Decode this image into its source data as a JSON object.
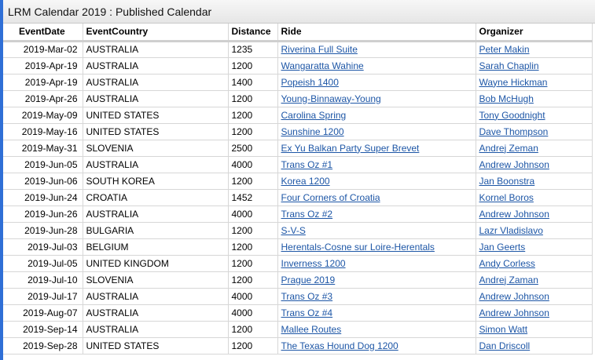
{
  "window": {
    "title": "LRM Calendar 2019 : Published Calendar"
  },
  "table": {
    "columns": [
      "EventDate",
      "EventCountry",
      "Distance",
      "Ride",
      "Organizer"
    ],
    "rows": [
      [
        "2019-Mar-02",
        "AUSTRALIA",
        "1235",
        "Riverina Full Suite",
        "Peter Makin"
      ],
      [
        "2019-Apr-19",
        "AUSTRALIA",
        "1200",
        "Wangaratta Wahine",
        "Sarah Chaplin"
      ],
      [
        "2019-Apr-19",
        "AUSTRALIA",
        "1400",
        "Popeish 1400",
        "Wayne Hickman"
      ],
      [
        "2019-Apr-26",
        "AUSTRALIA",
        "1200",
        "Young-Binnaway-Young",
        "Bob McHugh"
      ],
      [
        "2019-May-09",
        "UNITED STATES",
        "1200",
        "Carolina Spring",
        "Tony Goodnight"
      ],
      [
        "2019-May-16",
        "UNITED STATES",
        "1200",
        "Sunshine 1200",
        "Dave Thompson"
      ],
      [
        "2019-May-31",
        "SLOVENIA",
        "2500",
        "Ex Yu Balkan Party Super Brevet",
        "Andrej Zeman"
      ],
      [
        "2019-Jun-05",
        "AUSTRALIA",
        "4000",
        "Trans Oz #1",
        "Andrew Johnson"
      ],
      [
        "2019-Jun-06",
        "SOUTH KOREA",
        "1200",
        "Korea 1200",
        "Jan Boonstra"
      ],
      [
        "2019-Jun-24",
        "CROATIA",
        "1452",
        "Four Corners of Croatia",
        "Kornel Boros"
      ],
      [
        "2019-Jun-26",
        "AUSTRALIA",
        "4000",
        "Trans Oz #2",
        "Andrew Johnson"
      ],
      [
        "2019-Jun-28",
        "BULGARIA",
        "1200",
        "S-V-S",
        "Lazr Vladislavo"
      ],
      [
        "2019-Jul-03",
        "BELGIUM",
        "1200",
        "Herentals-Cosne sur Loire-Herentals",
        "Jan Geerts"
      ],
      [
        "2019-Jul-05",
        "UNITED KINGDOM",
        "1200",
        "Inverness 1200",
        "Andy Corless"
      ],
      [
        "2019-Jul-10",
        "SLOVENIA",
        "1200",
        "Prague 2019",
        "Andrej Zaman"
      ],
      [
        "2019-Jul-17",
        "AUSTRALIA",
        "4000",
        "Trans Oz #3",
        "Andrew Johnson"
      ],
      [
        "2019-Aug-07",
        "AUSTRALIA",
        "4000",
        "Trans Oz #4",
        "Andrew Johnson"
      ],
      [
        "2019-Sep-14",
        "AUSTRALIA",
        "1200",
        "Mallee Routes",
        "Simon Watt"
      ],
      [
        "2019-Sep-28",
        "UNITED STATES",
        "1200",
        "The Texas Hound Dog 1200",
        "Dan Driscoll"
      ]
    ]
  },
  "colors": {
    "accent": "#2f6fd6",
    "link": "#1d56a6"
  }
}
